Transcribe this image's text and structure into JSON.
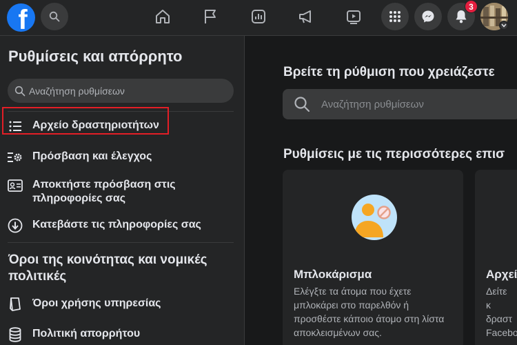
{
  "topbar": {
    "logo_letter": "f",
    "notifications_badge": "3",
    "icons": [
      "facebook-logo",
      "search-icon",
      "home-icon",
      "flag-icon",
      "chart-icon",
      "megaphone-icon",
      "video-icon",
      "menu-grid-icon",
      "messenger-icon",
      "bell-icon",
      "avatar",
      "chevron-down-icon"
    ]
  },
  "sidebar": {
    "title": "Ρυθμίσεις και απόρρητο",
    "search_placeholder": "Αναζήτηση ρυθμίσεων",
    "items": [
      {
        "label": "Αρχείο δραστηριοτήτων",
        "icon": "list-icon"
      },
      {
        "label": "Πρόσβαση και έλεγχος",
        "icon": "settings-list-icon"
      },
      {
        "label": "Αποκτήστε πρόσβαση στις πληροφορίες σας",
        "icon": "id-card-icon"
      },
      {
        "label": "Κατεβάστε τις πληροφορίες σας",
        "icon": "download-icon"
      }
    ],
    "section_title": "Όροι της κοινότητας και νομικές πολιτικές",
    "policy_items": [
      {
        "label": "Όροι χρήσης υπηρεσίας",
        "icon": "book-icon"
      },
      {
        "label": "Πολιτική απορρήτου",
        "icon": "database-icon"
      }
    ]
  },
  "main": {
    "title": "Βρείτε τη ρύθμιση που χρειάζεστε",
    "search_placeholder": "Αναζήτηση ρυθμίσεων",
    "section_title": "Ρυθμίσεις με τις περισσότερες επισ",
    "cards": [
      {
        "title": "Μπλοκάρισμα",
        "description": "Ελέγξτε τα άτομα που έχετε μπλοκάρει στο παρελθόν ή προσθέστε κάποιο άτομο στη λίστα αποκλεισμένων σας."
      },
      {
        "title": "Αρχεί",
        "description": "Δείτε κ δραστ Facebo"
      }
    ]
  },
  "colors": {
    "accent": "#1877f2",
    "highlight_border": "#e41e26",
    "badge": "#e41e3f"
  }
}
